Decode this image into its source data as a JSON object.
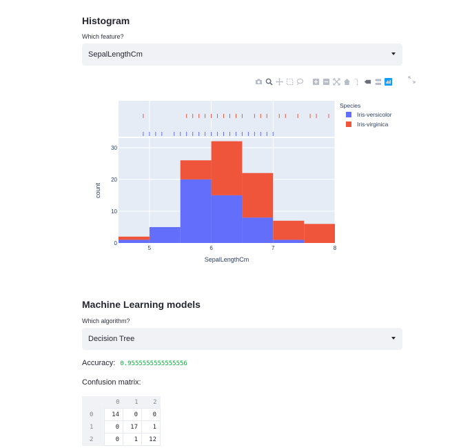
{
  "histogram_section": {
    "title": "Histogram",
    "feature_label": "Which feature?",
    "feature_value": "SepalLengthCm"
  },
  "modebar": {
    "icons": [
      "camera-icon",
      "zoom-icon",
      "pan-icon",
      "box-select-icon",
      "lasso-icon",
      "zoom-in-icon",
      "zoom-out-icon",
      "autoscale-icon",
      "home-icon",
      "spike-lines-icon",
      "hover-closest-icon",
      "hover-compare-icon",
      "plotly-logo-icon"
    ],
    "fullscreen_icon": "expand-icon"
  },
  "chart_data": {
    "type": "bar",
    "mode": "stacked-histogram",
    "bin_edges": [
      4.5,
      5.0,
      5.5,
      6.0,
      6.5,
      7.0,
      7.5,
      8.0
    ],
    "series": [
      {
        "name": "Iris-versicolor",
        "color": "#636efa",
        "values": [
          1,
          5,
          20,
          15,
          8,
          1,
          0
        ]
      },
      {
        "name": "Iris-virginica",
        "color": "#ef553b",
        "values": [
          1,
          0,
          6,
          17,
          14,
          6,
          6
        ]
      }
    ],
    "xlabel": "SepalLengthCm",
    "ylabel": "count",
    "xlim": [
      4.5,
      8.0
    ],
    "ylim": [
      0,
      33
    ],
    "xticks": [
      "5",
      "6",
      "7",
      "8"
    ],
    "yticks": [
      "0",
      "10",
      "20",
      "30"
    ],
    "legend_title": "Species",
    "legend_position": "top-right",
    "grid": true,
    "rug": {
      "Iris-virginica": [
        4.9,
        5.6,
        5.7,
        5.8,
        5.9,
        6.0,
        6.1,
        6.2,
        6.3,
        6.4,
        6.5,
        6.7,
        6.8,
        6.9,
        7.1,
        7.2,
        7.4,
        7.6,
        7.7,
        7.9
      ],
      "Iris-versicolor": [
        4.9,
        5.0,
        5.1,
        5.2,
        5.4,
        5.5,
        5.6,
        5.7,
        5.8,
        5.9,
        6.0,
        6.1,
        6.2,
        6.3,
        6.4,
        6.5,
        6.6,
        6.7,
        6.8,
        6.9,
        7.0
      ]
    }
  },
  "ml_section": {
    "title": "Machine Learning models",
    "algo_label": "Which algorithm?",
    "algo_value": "Decision Tree",
    "accuracy_label": "Accuracy:",
    "accuracy_value": "0.9555555555555556",
    "accuracy_color": "#09ab3b",
    "cm_label": "Confusion matrix:",
    "cm_columns": [
      "0",
      "1",
      "2"
    ],
    "cm_rows": [
      {
        "index": "0",
        "cells": [
          "14",
          "0",
          "0"
        ]
      },
      {
        "index": "1",
        "cells": [
          "0",
          "17",
          "1"
        ]
      },
      {
        "index": "2",
        "cells": [
          "0",
          "1",
          "12"
        ]
      }
    ]
  }
}
